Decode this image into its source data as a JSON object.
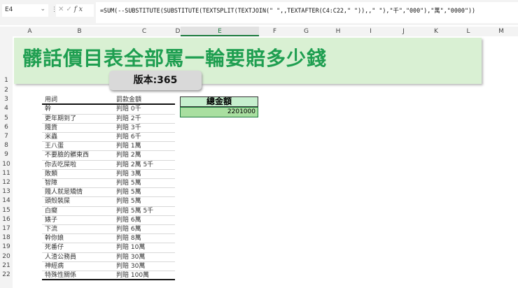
{
  "namebox": "E4",
  "formula": "=SUM(--SUBSTITUTE(SUBSTITUTE(TEXTSPLIT(TEXTJOIN(\" \",,TEXTAFTER(C4:C22,\" \")),,\" \"),\"千\",\"000\"),\"萬\",\"0000\"))",
  "columns": [
    "A",
    "B",
    "C",
    "D",
    "E",
    "F",
    "G",
    "H",
    "I",
    "J",
    "K",
    "L",
    "M"
  ],
  "rows": [
    "1",
    "2",
    "3",
    "4",
    "5",
    "6",
    "7",
    "8",
    "9",
    "10",
    "11",
    "12",
    "13",
    "14",
    "15",
    "16",
    "17",
    "18",
    "19",
    "20",
    "21",
    "22"
  ],
  "title": "髒話價目表全部罵一輪要賠多少錢",
  "version": "版本:365",
  "table": {
    "headers": [
      "用詞",
      "罰款金額"
    ],
    "rows": [
      [
        "幹",
        "判賠 0千"
      ],
      [
        "更年期到了",
        "判賠 2千"
      ],
      [
        "賤貨",
        "判賠 3千"
      ],
      [
        "米蟲",
        "判賠 6千"
      ],
      [
        "王八蛋",
        "判賠 1萬"
      ],
      [
        "不要臉的髒東西",
        "判賠 2萬"
      ],
      [
        "你去吃屎啦",
        "判賠 2萬 5千"
      ],
      [
        "敗類",
        "判賠 3萬"
      ],
      [
        "智障",
        "判賠 5萬"
      ],
      [
        "賤人就是矯情",
        "判賠 5萬"
      ],
      [
        "頭殼裝屎",
        "判賠 5萬"
      ],
      [
        "白癡",
        "判賠 5萬 5千"
      ],
      [
        "婊子",
        "判賠 6萬"
      ],
      [
        "下流",
        "判賠 6萬"
      ],
      [
        "幹你娘",
        "判賠 8萬"
      ],
      [
        "死番仔",
        "判賠 10萬"
      ],
      [
        "人渣公務員",
        "判賠 30萬"
      ],
      [
        "神經病",
        "判賠 30萬"
      ],
      [
        "特殊性關係",
        "判賠 100萬"
      ]
    ]
  },
  "total": {
    "label": "總金額",
    "value": "2201000"
  }
}
